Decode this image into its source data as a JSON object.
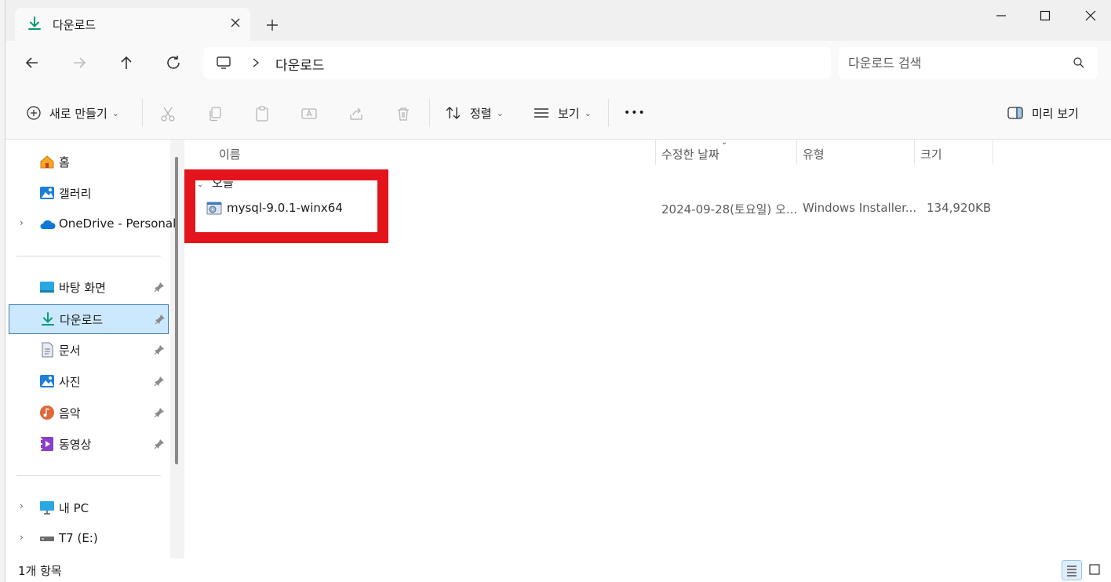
{
  "window": {
    "tab_title": "다운로드",
    "new_tab_symbol": "+"
  },
  "address": {
    "breadcrumb": "다운로드",
    "search_placeholder": "다운로드 검색"
  },
  "toolbar": {
    "new_label": "새로 만들기",
    "sort_label": "정렬",
    "view_label": "보기",
    "more_symbol": "•••",
    "preview_label": "미리 보기"
  },
  "sidebar": {
    "home": "홈",
    "gallery": "갤러리",
    "onedrive": "OneDrive - Personal",
    "desktop": "바탕 화면",
    "downloads": "다운로드",
    "documents": "문서",
    "pictures": "사진",
    "music": "음악",
    "videos": "동영상",
    "this_pc": "내 PC",
    "drive": "T7 (E:)"
  },
  "columns": {
    "name": "이름",
    "modified": "수정한 날짜",
    "type": "유형",
    "size": "크기"
  },
  "group_header": "오늘",
  "files": [
    {
      "name": "mysql-9.0.1-winx64",
      "modified": "2024-09-28(토요일) 오...",
      "type": "Windows Installer...",
      "size": "134,920KB"
    }
  ],
  "status": {
    "item_count": "1개 항목"
  },
  "colors": {
    "accent": "#0067c0",
    "selection": "#cce8ff",
    "highlight_box": "#e3141b"
  }
}
